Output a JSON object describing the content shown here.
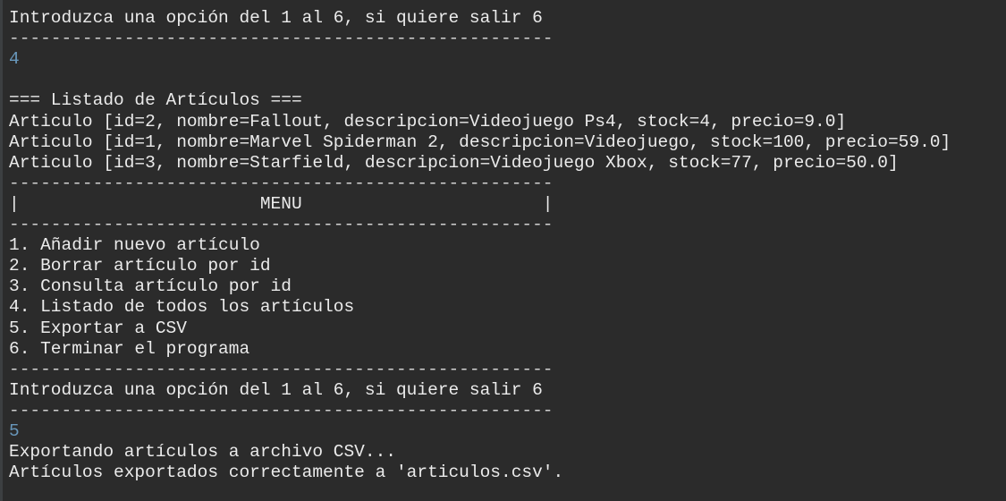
{
  "console": {
    "lines": [
      {
        "text": "----------------------------------------------------",
        "kind": "separator"
      },
      {
        "text": "Introduzca una opción del 1 al 6, si quiere salir 6",
        "kind": "output"
      },
      {
        "text": "----------------------------------------------------",
        "kind": "separator"
      },
      {
        "text": "4",
        "kind": "input"
      },
      {
        "text": "",
        "kind": "blank"
      },
      {
        "text": "=== Listado de Artículos ===",
        "kind": "output"
      },
      {
        "text": "Articulo [id=2, nombre=Fallout, descripcion=Videojuego Ps4, stock=4, precio=9.0]",
        "kind": "output"
      },
      {
        "text": "Articulo [id=1, nombre=Marvel Spiderman 2, descripcion=Videojuego, stock=100, precio=59.0]",
        "kind": "output"
      },
      {
        "text": "Articulo [id=3, nombre=Starfield, descripcion=Videojuego Xbox, stock=77, precio=50.0]",
        "kind": "output"
      },
      {
        "text": "----------------------------------------------------",
        "kind": "separator"
      },
      {
        "text": "|                       MENU                       |",
        "kind": "output"
      },
      {
        "text": "----------------------------------------------------",
        "kind": "separator"
      },
      {
        "text": "1. Añadir nuevo artículo",
        "kind": "output"
      },
      {
        "text": "2. Borrar artículo por id",
        "kind": "output"
      },
      {
        "text": "3. Consulta artículo por id",
        "kind": "output"
      },
      {
        "text": "4. Listado de todos los artículos",
        "kind": "output"
      },
      {
        "text": "5. Exportar a CSV",
        "kind": "output"
      },
      {
        "text": "6. Terminar el programa",
        "kind": "output"
      },
      {
        "text": "----------------------------------------------------",
        "kind": "separator"
      },
      {
        "text": "Introduzca una opción del 1 al 6, si quiere salir 6",
        "kind": "output"
      },
      {
        "text": "----------------------------------------------------",
        "kind": "separator"
      },
      {
        "text": "5",
        "kind": "input"
      },
      {
        "text": "Exportando artículos a archivo CSV...",
        "kind": "output"
      },
      {
        "text": "Artículos exportados correctamente a 'articulos.csv'.",
        "kind": "output"
      }
    ]
  },
  "colors": {
    "background": "#2b2b2b",
    "output_text": "#ebebeb",
    "user_input": "#6897bb"
  }
}
